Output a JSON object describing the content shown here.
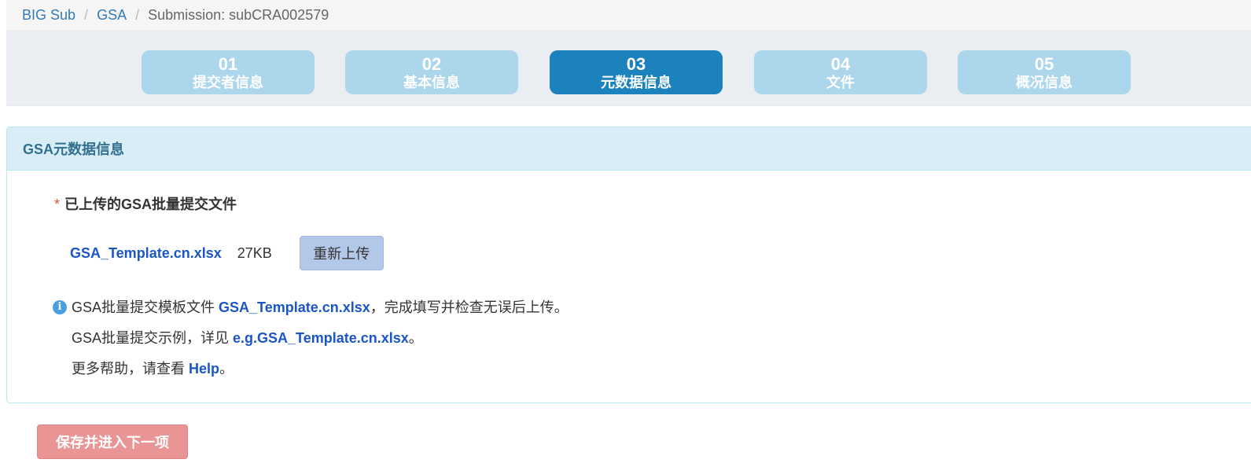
{
  "breadcrumb": {
    "items": [
      "BIG Sub",
      "GSA"
    ],
    "current": "Submission: subCRA002579",
    "separator": "/"
  },
  "steps": [
    {
      "num": "01",
      "label": "提交者信息",
      "active": false
    },
    {
      "num": "02",
      "label": "基本信息",
      "active": false
    },
    {
      "num": "03",
      "label": "元数据信息",
      "active": true
    },
    {
      "num": "04",
      "label": "文件",
      "active": false
    },
    {
      "num": "05",
      "label": "概况信息",
      "active": false
    }
  ],
  "panel": {
    "title": "GSA元数据信息",
    "required_mark": "*",
    "uploaded_label": "已上传的GSA批量提交文件",
    "file_name": "GSA_Template.cn.xlsx",
    "file_size": "27KB",
    "reupload_label": "重新上传",
    "info_icon": "info-icon",
    "line1_prefix": "GSA批量提交模板文件 ",
    "line1_link": "GSA_Template.cn.xlsx",
    "line1_suffix": "，完成填写并检查无误后上传。",
    "line2_prefix": "GSA批量提交示例，详见 ",
    "line2_link": "e.g.GSA_Template.cn.xlsx",
    "line2_suffix": "。",
    "line3_prefix": "更多帮助，请查看 ",
    "line3_link": "Help",
    "line3_suffix": "。"
  },
  "footer": {
    "save_label": "保存并进入下一项"
  },
  "colors": {
    "step_active": "#1b82bd",
    "step_inactive": "#abd6ec",
    "link": "#1a56c8",
    "save_button": "#e99595"
  }
}
